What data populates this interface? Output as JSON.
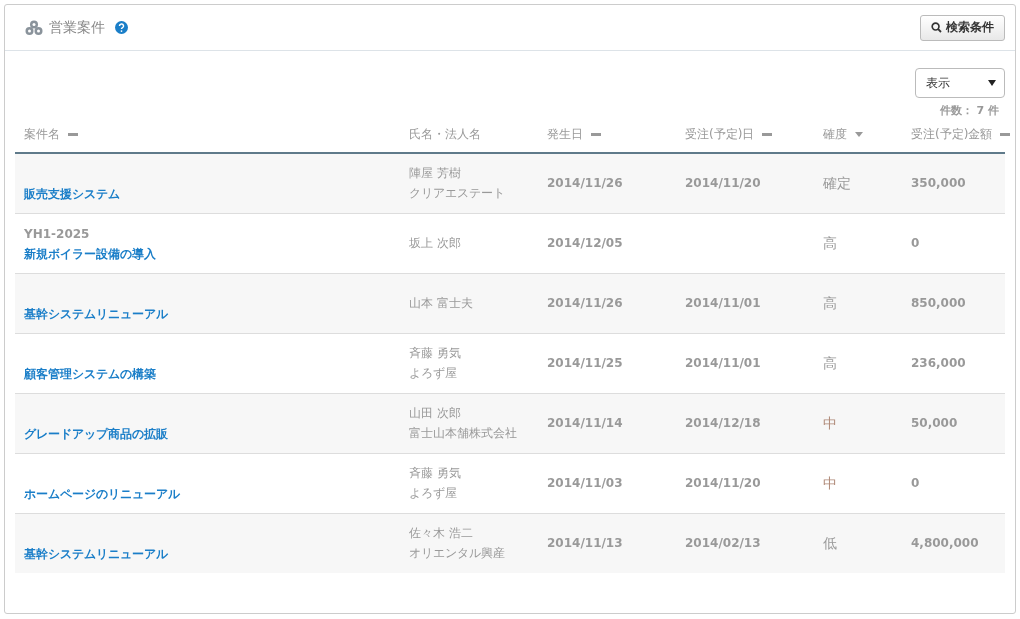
{
  "panel": {
    "title": "営業案件",
    "search_button": "検索条件"
  },
  "view_select": {
    "value": "表示"
  },
  "count": "件数： 7 件",
  "table": {
    "columns": [
      {
        "label": "案件名",
        "sorted": false
      },
      {
        "label": "氏名・法人名"
      },
      {
        "label": "発生日",
        "sorted": false
      },
      {
        "label": "受注(予定)日",
        "sorted": false
      },
      {
        "label": "確度",
        "sorted": true
      },
      {
        "label": "受注(予定)金額",
        "sorted": false
      }
    ],
    "rows": [
      {
        "name": "販売支援システム",
        "person": "陣屋 芳樹",
        "company": "クリアエステート",
        "date": "2014/11/26",
        "order_date": "2014/11/20",
        "confidence": "確定",
        "color": "#999999",
        "amount": "350,000"
      },
      {
        "code": "YH1-2025",
        "name": "新規ボイラー設備の導入",
        "person": "坂上 次郎",
        "date": "2014/12/05",
        "confidence": "高",
        "color": "#999999",
        "amount": "0"
      },
      {
        "name": "基幹システムリニューアル",
        "person": "山本 富士夫",
        "date": "2014/11/26",
        "order_date": "2014/11/01",
        "confidence": "高",
        "color": "#999999",
        "amount": "850,000"
      },
      {
        "name": "顧客管理システムの構築",
        "person": "斉藤 勇気",
        "company": "よろず屋",
        "date": "2014/11/25",
        "order_date": "2014/11/01",
        "confidence": "高",
        "color": "#999999",
        "amount": "236,000"
      },
      {
        "name": "グレードアップ商品の拡販",
        "person": "山田 次郎",
        "company": "富士山本舗株式会社",
        "date": "2014/11/14",
        "order_date": "2014/12/18",
        "confidence": "中",
        "color": "#b08a78",
        "amount": "50,000"
      },
      {
        "name": "ホームページのリニューアル",
        "person": "斉藤 勇気",
        "company": "よろず屋",
        "date": "2014/11/03",
        "order_date": "2014/11/20",
        "confidence": "中",
        "color": "#b08a78",
        "amount": "0"
      },
      {
        "name": "基幹システムリニューアル",
        "person": "佐々木 浩二",
        "company": "オリエンタル興産",
        "date": "2014/11/13",
        "order_date": "2014/02/13",
        "confidence": "低",
        "color": "#999999",
        "amount": "4,800,000"
      }
    ]
  }
}
